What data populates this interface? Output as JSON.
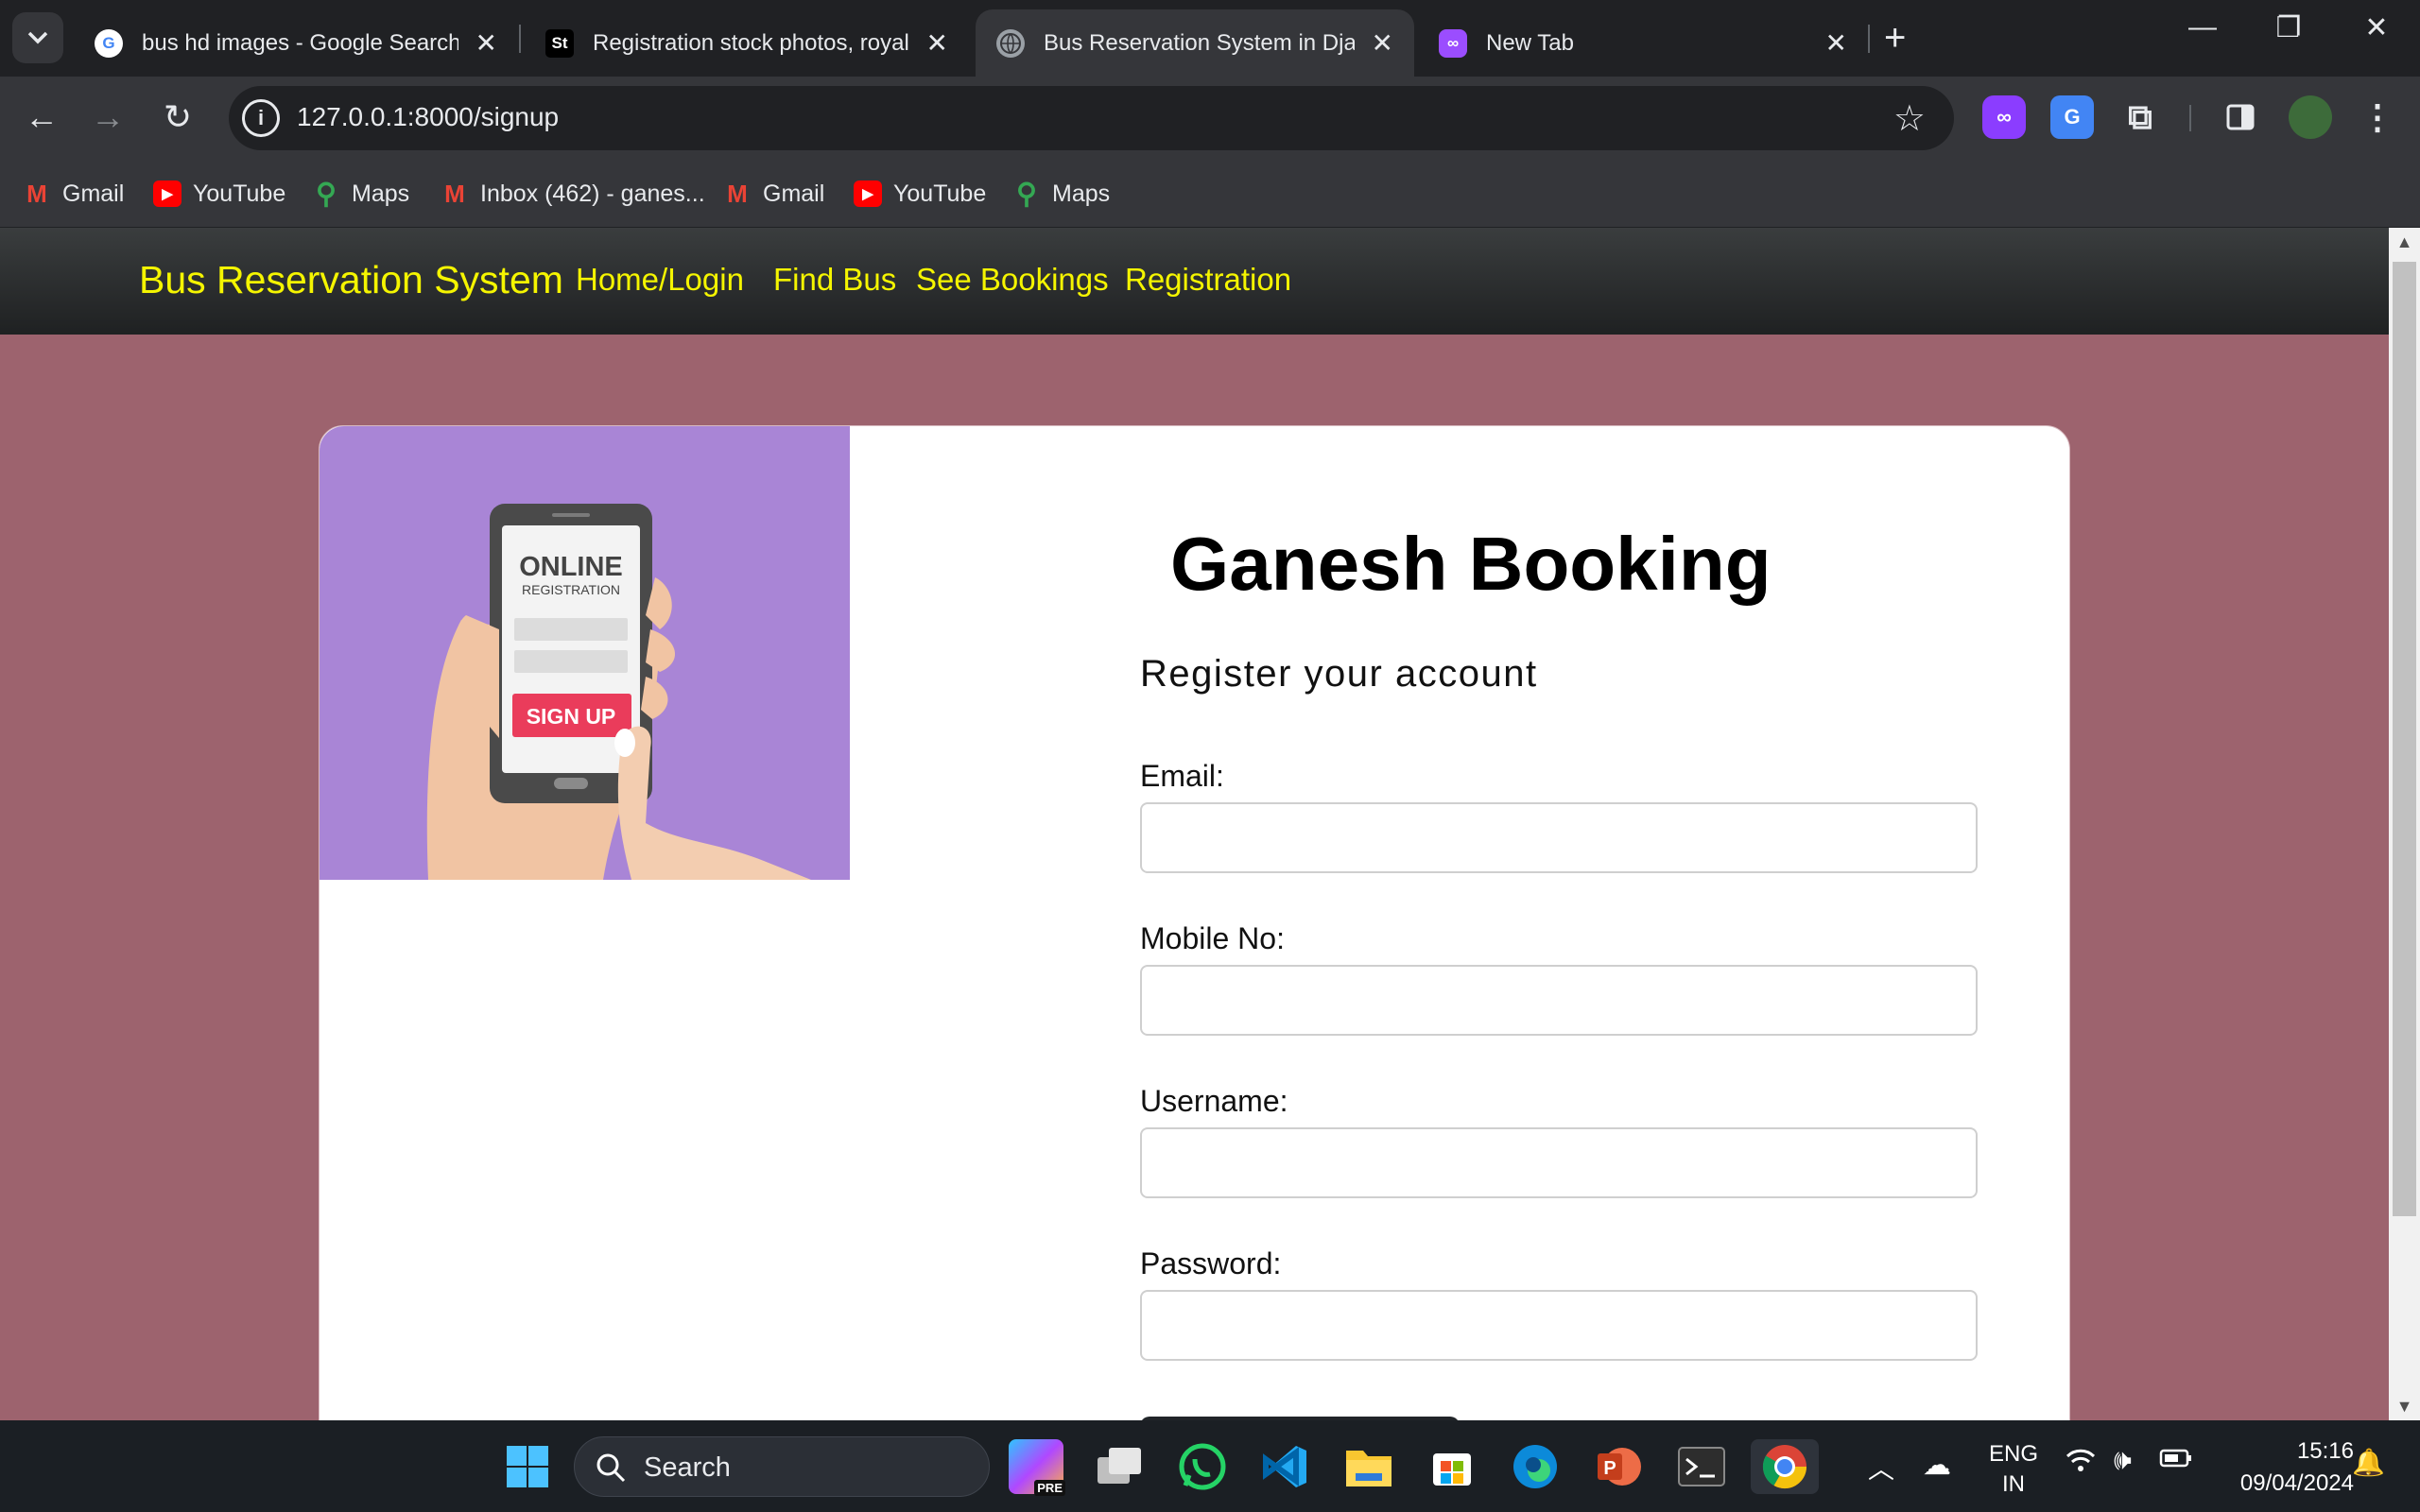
{
  "browser": {
    "tabs": [
      {
        "title": "bus hd images - Google Search",
        "favicon": "google-icon"
      },
      {
        "title": "Registration stock photos, royal",
        "favicon": "shutterstock-icon",
        "favicon_text": "St"
      },
      {
        "title": "Bus Reservation System in Djan",
        "favicon": "globe-icon"
      },
      {
        "title": "New Tab",
        "favicon": "new-tab-icon"
      }
    ],
    "url": "127.0.0.1:8000/signup",
    "bookmarks": [
      {
        "label": "Gmail",
        "icon": "gmail-icon"
      },
      {
        "label": "YouTube",
        "icon": "youtube-icon"
      },
      {
        "label": "Maps",
        "icon": "maps-icon"
      },
      {
        "label": "Inbox (462) - ganes...",
        "icon": "gmail-icon"
      },
      {
        "label": "Gmail",
        "icon": "gmail-icon"
      },
      {
        "label": "YouTube",
        "icon": "youtube-icon"
      },
      {
        "label": "Maps",
        "icon": "maps-icon"
      }
    ]
  },
  "site": {
    "brand": "Bus Reservation System",
    "nav": [
      "Home/Login",
      "Find Bus",
      "See Bookings",
      "Registration"
    ],
    "navbar_text_color": "#f5f500",
    "background_color": "#9d636e"
  },
  "illustration": {
    "heading": "ONLINE",
    "subheading": "REGISTRATION",
    "button": "SIGN UP"
  },
  "form": {
    "title": "Ganesh Booking",
    "subtitle": "Register your account",
    "fields": [
      {
        "label": "Email:",
        "value": ""
      },
      {
        "label": "Mobile No:",
        "value": ""
      },
      {
        "label": "Username:",
        "value": ""
      },
      {
        "label": "Password:",
        "value": ""
      }
    ]
  },
  "taskbar": {
    "search_label": "Search",
    "language": "ENG",
    "region": "IN",
    "time": "15:16",
    "date": "09/04/2024",
    "copilot_badge": "PRE"
  }
}
